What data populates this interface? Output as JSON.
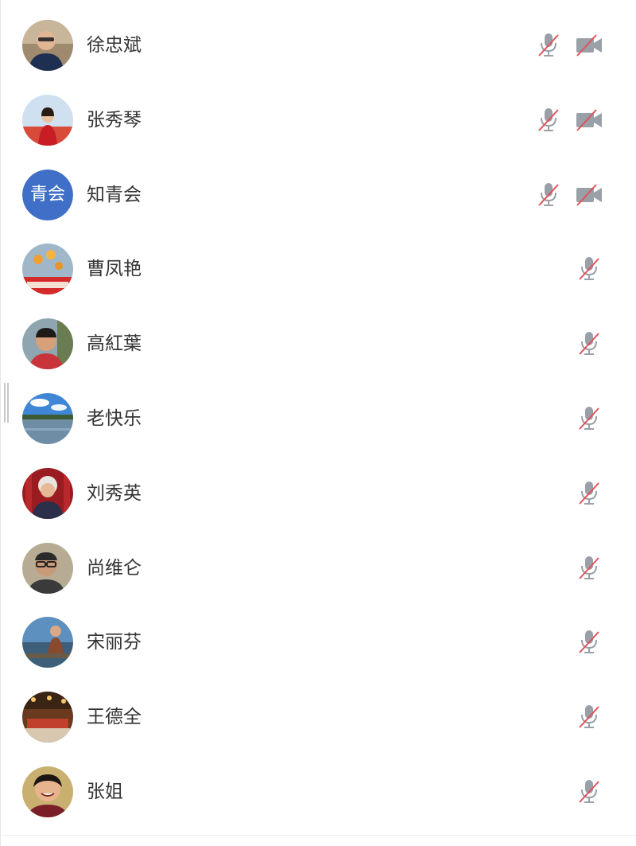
{
  "participants": [
    {
      "name": "徐忠斌",
      "avatar": "photo-man-glasses",
      "muted": true,
      "camera_off": true
    },
    {
      "name": "张秀琴",
      "avatar": "photo-woman-red",
      "muted": true,
      "camera_off": true
    },
    {
      "name": "知青会",
      "avatar_text": "青会",
      "muted": true,
      "camera_off": true
    },
    {
      "name": "曹凤艳",
      "avatar": "photo-flowers",
      "muted": true,
      "camera_off": false
    },
    {
      "name": "高紅葉",
      "avatar": "photo-man-smiling",
      "muted": true,
      "camera_off": false
    },
    {
      "name": "老快乐",
      "avatar": "photo-lake",
      "muted": true,
      "camera_off": false
    },
    {
      "name": "刘秀英",
      "avatar": "photo-woman-white-hair",
      "muted": true,
      "camera_off": false
    },
    {
      "name": "尚维仑",
      "avatar": "photo-man-glasses-dark",
      "muted": true,
      "camera_off": false
    },
    {
      "name": "宋丽芬",
      "avatar": "photo-woman-boat",
      "muted": true,
      "camera_off": false
    },
    {
      "name": "王德全",
      "avatar": "photo-people-table",
      "muted": true,
      "camera_off": false
    },
    {
      "name": "张姐",
      "avatar": "photo-woman-smiling",
      "muted": true,
      "camera_off": false
    }
  ],
  "colors": {
    "icon_gray": "#9aa0a8",
    "slash_red": "#e0525a",
    "text": "#333333",
    "avatar_blue": "#3f6fc6"
  }
}
